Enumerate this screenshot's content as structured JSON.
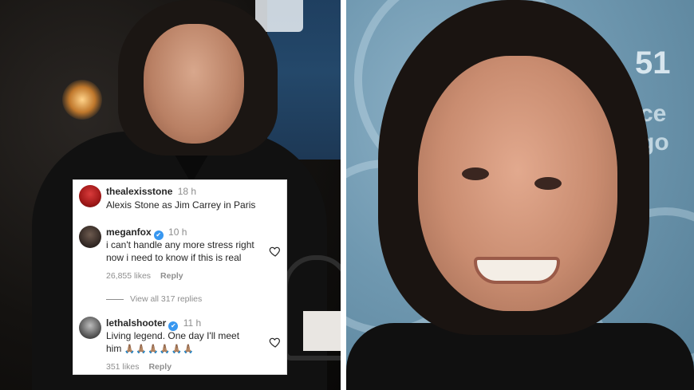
{
  "comments": [
    {
      "username": "thealexisstone",
      "time": "18 h",
      "text": "Alexis Stone as Jim Carrey in Paris"
    },
    {
      "username": "meganfox",
      "verified": "✔",
      "time": "10 h",
      "text_line1": "i can't handle any more stress right",
      "text_line2": "now i need to know if this is real",
      "likes": "26,855 likes",
      "reply": "Reply"
    },
    {
      "view_replies": "View all 317 replies"
    },
    {
      "username": "lethalshooter",
      "verified": "✔",
      "time": "11 h",
      "text_line1": "Living legend. One day I'll meet",
      "text_line2": "him",
      "emojis": "🙏🏽🙏🏽🙏🏽🙏🏽🙏🏽🙏🏽",
      "likes": "351 likes",
      "reply": "Reply"
    }
  ],
  "background_text": {
    "right_top": "51",
    "right_mid": "ce",
    "right_low": "go"
  },
  "colors": {
    "verified": "#3897f0",
    "secondary_text": "#8e8e8e",
    "primary_text": "#262626"
  }
}
